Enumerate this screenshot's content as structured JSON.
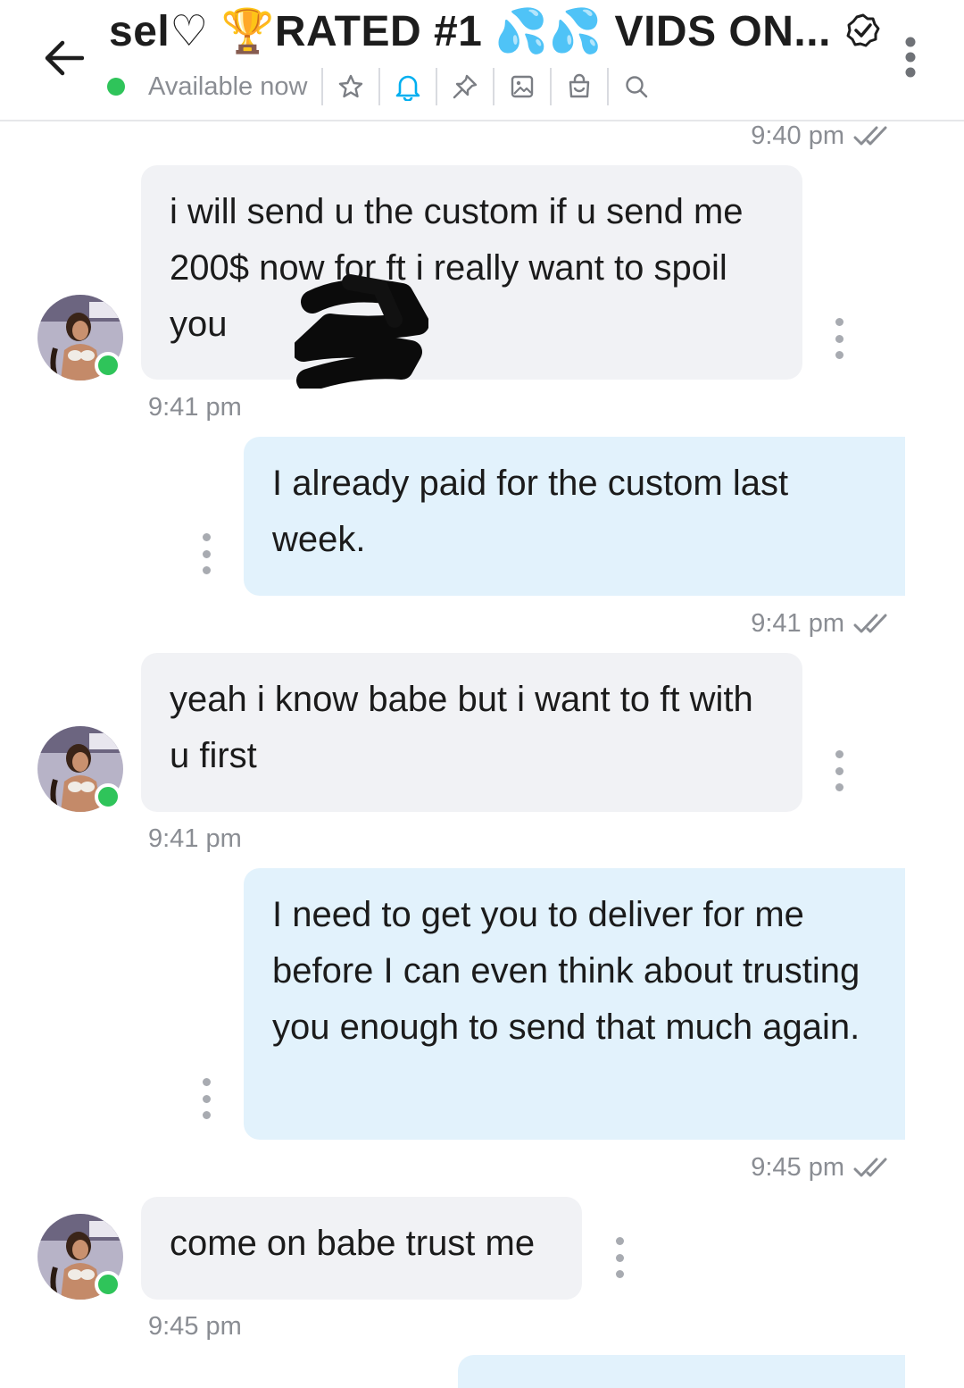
{
  "header": {
    "title": "sel♡ 🏆RATED #1 💦💦 VIDS ON...",
    "status": "Available now",
    "tools": [
      "star-icon",
      "bell-icon",
      "pin-icon",
      "image-icon",
      "bag-icon",
      "search-icon"
    ],
    "colors": {
      "online": "#2fc45a",
      "accent": "#00aff0"
    }
  },
  "messages": [
    {
      "from": "me",
      "time": "9:40 pm"
    },
    {
      "from": "them",
      "text": "i will send u the custom if u send me 200$ now for ft i really want to spoil you",
      "time": "9:41 pm"
    },
    {
      "from": "me",
      "text": "I already paid for the custom last week.",
      "time": "9:41 pm"
    },
    {
      "from": "them",
      "text": "yeah i know babe but i want to ft with u first",
      "time": "9:41 pm"
    },
    {
      "from": "me",
      "text": "I need to get you to deliver for me before I can even think about trusting you enough to send that much again.",
      "time": "9:45 pm"
    },
    {
      "from": "them",
      "text": "come on babe trust me",
      "time": "9:45 pm"
    },
    {
      "from": "me",
      "text": ""
    }
  ]
}
